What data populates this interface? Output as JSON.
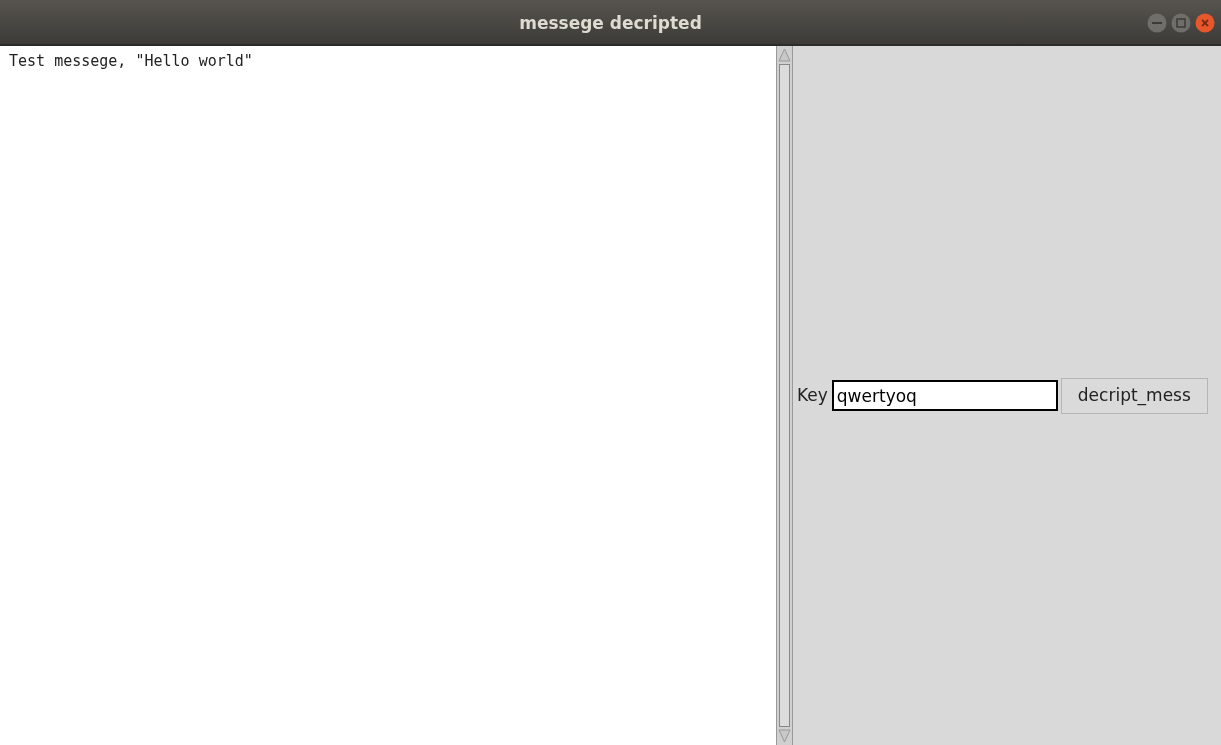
{
  "window": {
    "title": "messege decripted"
  },
  "text_area": {
    "value": "Test messege, \"Hello world\""
  },
  "key_label": "Key",
  "key_field": {
    "value": "qwertyoq"
  },
  "button": {
    "label": "decript_mess"
  }
}
